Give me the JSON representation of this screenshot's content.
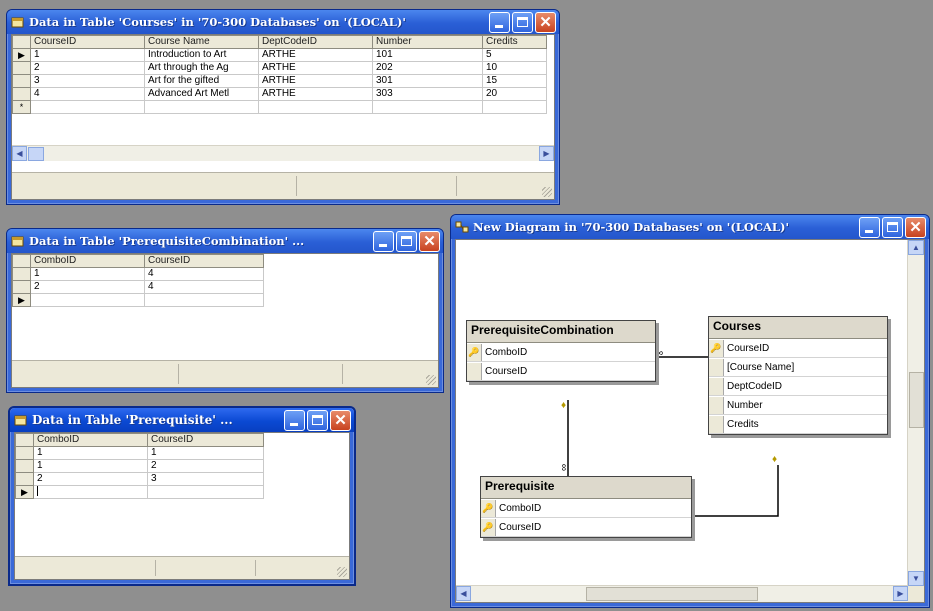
{
  "courses_window": {
    "title": "Data in Table 'Courses' in '70-300 Databases' on '(LOCAL)'",
    "columns": [
      "CourseID",
      "Course Name",
      "DeptCodeID",
      "Number",
      "Credits"
    ],
    "rows": [
      [
        "1",
        "Introduction to Art",
        "ARTHE",
        "101",
        "5"
      ],
      [
        "2",
        "Art through the Ag",
        "ARTHE",
        "202",
        "10"
      ],
      [
        "3",
        "Art for the gifted",
        "ARTHE",
        "301",
        "15"
      ],
      [
        "4",
        "Advanced Art Metl",
        "ARTHE",
        "303",
        "20"
      ]
    ],
    "new_row_marker": "*",
    "current_row_marker": "▶"
  },
  "prereq_combo_window": {
    "title": "Data in Table 'PrerequisiteCombination' ...",
    "columns": [
      "ComboID",
      "CourseID"
    ],
    "rows": [
      [
        "1",
        "4"
      ],
      [
        "2",
        "4"
      ]
    ]
  },
  "prereq_window": {
    "title": "Data in Table 'Prerequisite' ...",
    "columns": [
      "ComboID",
      "CourseID"
    ],
    "rows": [
      [
        "1",
        "1"
      ],
      [
        "1",
        "2"
      ],
      [
        "2",
        "3"
      ]
    ]
  },
  "diagram_window": {
    "title": "New Diagram in '70-300 Databases' on '(LOCAL)'",
    "entities": {
      "combo": {
        "name": "PrerequisiteCombination",
        "fields": [
          "ComboID",
          "CourseID"
        ]
      },
      "courses": {
        "name": "Courses",
        "fields": [
          "CourseID",
          "[Course Name]",
          "DeptCodeID",
          "Number",
          "Credits"
        ]
      },
      "prereq": {
        "name": "Prerequisite",
        "fields": [
          "ComboID",
          "CourseID"
        ]
      }
    },
    "relation_marks": {
      "many": "∞",
      "key": "♦"
    }
  },
  "colors": {
    "xp_title": "#2a5fd6",
    "desktop": "#8f8f8f",
    "close": "#c8421f"
  }
}
